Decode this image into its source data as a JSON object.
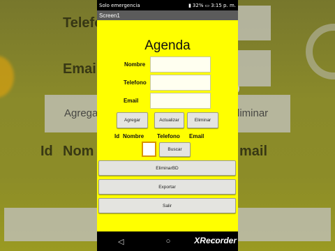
{
  "status_bar": {
    "carrier": "Solo emergencia",
    "battery": "32%",
    "time": "3:15 p. m."
  },
  "app": {
    "screen_title": "Screen1"
  },
  "form": {
    "heading": "Agenda",
    "fields": [
      {
        "label": "Nombre",
        "value": ""
      },
      {
        "label": "Telefono",
        "value": ""
      },
      {
        "label": "Email",
        "value": ""
      }
    ],
    "actions": {
      "add": "Agregar",
      "update": "Actualizar",
      "delete": "Eliminar"
    }
  },
  "list_header": {
    "id": "Id",
    "name": "Nombre",
    "phone": "Telefono",
    "email": "Email"
  },
  "search": {
    "id_value": "",
    "button": "Buscar"
  },
  "bottom_buttons": {
    "delete_db": "EliminarBD",
    "export": "Exportar",
    "exit": "Salir"
  },
  "background": {
    "labels": [
      "Telefo",
      "Email",
      "Agrega",
      "liminar",
      "Id",
      "Nom",
      "mail"
    ]
  },
  "navigation": {
    "back": "◁",
    "home": "○",
    "recent": "□"
  },
  "overlay": {
    "watermark": "XRecorder"
  },
  "colors": {
    "screen_bg": "#ffff00",
    "title_bar": "#5b5b5b",
    "id_box_border": "#d89400"
  }
}
